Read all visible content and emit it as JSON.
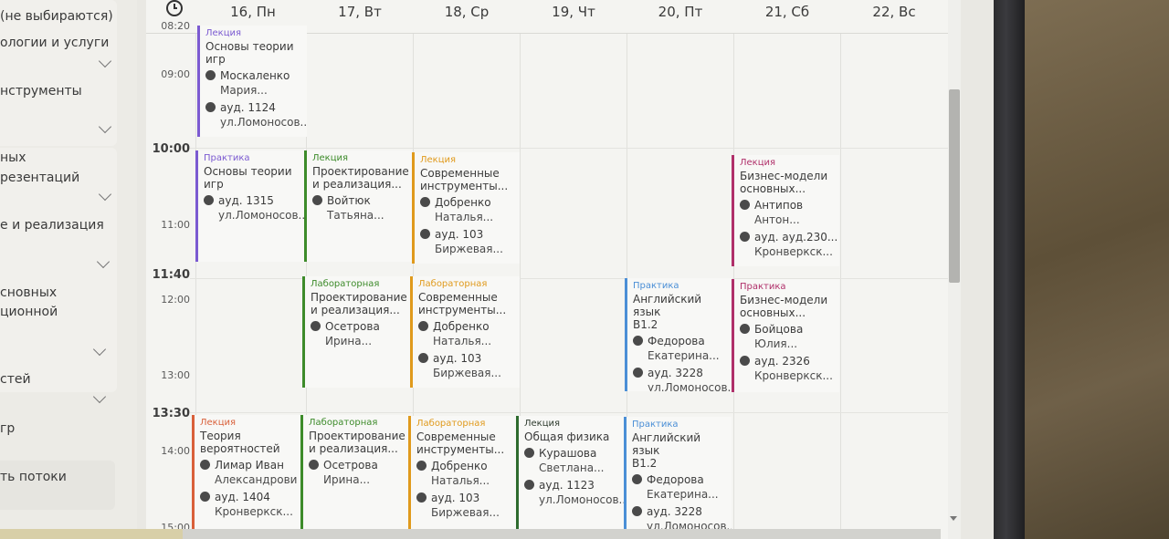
{
  "sidebar": {
    "items": [
      {
        "text": "(не выбираются)"
      },
      {
        "text": "ологии и услуги"
      },
      {
        "text": "нструменты"
      },
      {
        "text": "ных"
      },
      {
        "text": "резентаций"
      },
      {
        "text": "е и реализация"
      },
      {
        "text": "сновных"
      },
      {
        "text": "ционной"
      },
      {
        "text": "стей"
      },
      {
        "text": "гр"
      }
    ],
    "button_label": "ть потоки"
  },
  "header": {
    "clock_icon": "clock-icon",
    "days": [
      "16, Пн",
      "17, Вт",
      "18, Ср",
      "19, Чт",
      "20, Пт",
      "21, Сб",
      "22, Вс"
    ]
  },
  "times": [
    "08:20",
    "09:00",
    "10:00",
    "11:00",
    "11:40",
    "12:00",
    "13:00",
    "13:30",
    "14:00",
    "15:00"
  ],
  "colors": {
    "lecture_purple": "#7b5ad1",
    "green": "#3d8b2a",
    "orange": "#e09a1c",
    "blue": "#4b8fd6",
    "magenta": "#b0306a",
    "red_orange": "#d9603a",
    "dark_green": "#2e6b2e"
  },
  "events": [
    {
      "type": "Лекция",
      "title": [
        "Основы теории",
        "игр"
      ],
      "person": [
        "Москаленко",
        "Мария..."
      ],
      "room": [
        "ауд. 1124",
        "ул.Ломоносов.."
      ]
    },
    {
      "type": "Практика",
      "title": [
        "Основы теории",
        "игр"
      ],
      "room": [
        "ауд. 1315",
        "ул.Ломоносов.."
      ]
    },
    {
      "type": "Лекция",
      "title": [
        "Проектирование",
        "и реализация..."
      ],
      "person": [
        "Войтюк",
        "Татьяна..."
      ]
    },
    {
      "type": "Лекция",
      "title": [
        "Современные",
        "инструменты..."
      ],
      "person": [
        "Добренко",
        "Наталья..."
      ],
      "room": [
        "ауд. 103",
        "Биржевая..."
      ]
    },
    {
      "type": "Лекция",
      "title": [
        "Бизнес-модели",
        "основных..."
      ],
      "person": [
        "Антипов",
        "Антон..."
      ],
      "room": [
        "ауд. ауд.230...",
        "Кронверкск..."
      ]
    },
    {
      "type": "Лабораторная",
      "title": [
        "Проектирование",
        "и реализация..."
      ],
      "person": [
        "Осетрова",
        "Ирина..."
      ]
    },
    {
      "type": "Лабораторная",
      "title": [
        "Современные",
        "инструменты..."
      ],
      "person": [
        "Добренко",
        "Наталья..."
      ],
      "room": [
        "ауд. 103",
        "Биржевая..."
      ]
    },
    {
      "type": "Практика",
      "title": [
        "Английский язык",
        "B1.2"
      ],
      "person": [
        "Федорова",
        "Екатерина..."
      ],
      "room": [
        "ауд. 3228",
        "ул.Ломоносов.."
      ]
    },
    {
      "type": "Практика",
      "title": [
        "Бизнес-модели",
        "основных..."
      ],
      "person": [
        "Бойцова",
        "Юлия..."
      ],
      "room": [
        "ауд. 2326",
        "Кронверкск..."
      ]
    },
    {
      "type": "Лекция",
      "title": [
        "Теория",
        "вероятностей"
      ],
      "person": [
        "Лимар Иван",
        "Александрови"
      ],
      "room": [
        "ауд. 1404",
        "Кронверкск..."
      ]
    },
    {
      "type": "Лабораторная",
      "title": [
        "Проектирование",
        "и реализация..."
      ],
      "person": [
        "Осетрова",
        "Ирина..."
      ]
    },
    {
      "type": "Лабораторная",
      "title": [
        "Современные",
        "инструменты..."
      ],
      "person": [
        "Добренко",
        "Наталья..."
      ],
      "room": [
        "ауд. 103",
        "Биржевая..."
      ]
    },
    {
      "type": "Лекция",
      "title": [
        "Общая физика"
      ],
      "person": [
        "Курашова",
        "Светлана..."
      ],
      "room": [
        "ауд. 1123",
        "ул.Ломоносов.."
      ]
    },
    {
      "type": "Практика",
      "title": [
        "Английский язык",
        "B1.2"
      ],
      "person": [
        "Федорова",
        "Екатерина..."
      ],
      "room": [
        "ауд. 3228",
        "ул.Ломоносов.."
      ]
    }
  ]
}
